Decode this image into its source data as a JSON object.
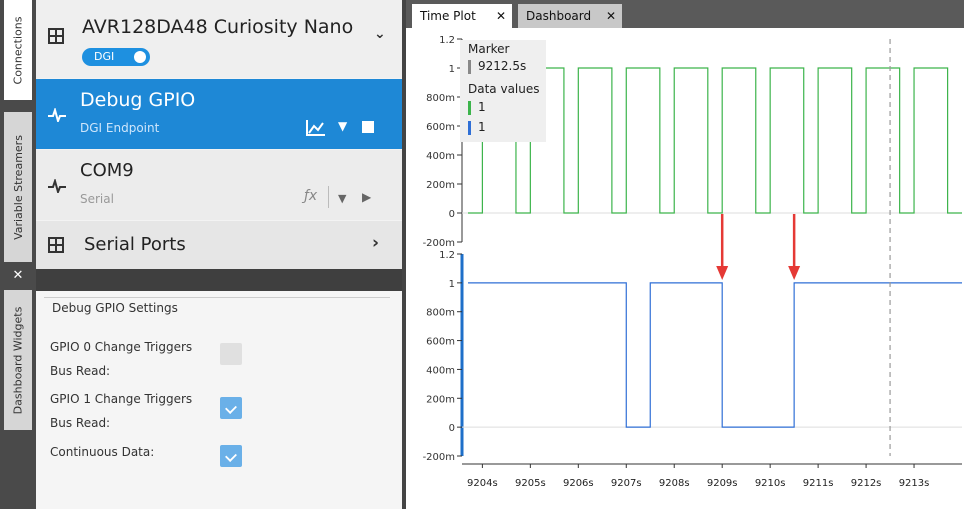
{
  "sidebar_tabs": [
    "Connections",
    "Variable Streamers",
    "Dashboard Widgets"
  ],
  "device": {
    "name": "AVR128DA48 Curiosity Nano",
    "badge": "DGI"
  },
  "sources": [
    {
      "title": "Debug GPIO",
      "subtitle": "DGI Endpoint"
    },
    {
      "title": "COM9",
      "subtitle": "Serial"
    }
  ],
  "serial_ports": {
    "label": "Serial Ports"
  },
  "settings": {
    "title": "Debug GPIO Settings",
    "items": [
      {
        "line1": "GPIO 0 Change Triggers",
        "line2": "Bus Read:",
        "checked": false
      },
      {
        "line1": "GPIO 1 Change Triggers",
        "line2": "Bus Read:",
        "checked": true
      },
      {
        "line1": "Continuous Data:",
        "line2": "",
        "checked": true
      }
    ]
  },
  "plot_tabs": [
    {
      "label": "Time Plot",
      "active": true
    },
    {
      "label": "Dashboard",
      "active": false
    }
  ],
  "legend": {
    "marker_title": "Marker",
    "marker_value": "9212.5s",
    "data_title": "Data values",
    "values": [
      "1",
      "1"
    ]
  },
  "colors": {
    "series_green": "#3cb44b",
    "series_blue": "#2f6fd6",
    "arrow": "#e53935",
    "accent": "#1e88d6"
  },
  "chart_data": [
    {
      "type": "line",
      "ylim": [
        -0.2,
        1.2
      ],
      "xlim": [
        9203.7,
        9214.0
      ],
      "ytick_labels": [
        "1.2",
        "1",
        "800m",
        "600m",
        "400m",
        "200m",
        "0",
        "-200m"
      ],
      "series": [
        {
          "x": [
            9203.7,
            9204.0,
            9204.0,
            9204.7,
            9204.7,
            9205.0,
            9205.0,
            9205.7,
            9205.7,
            9206.0,
            9206.0,
            9206.7,
            9206.7,
            9207.0,
            9207.0,
            9207.7,
            9207.7,
            9208.0,
            9208.0,
            9208.7,
            9208.7,
            9209.0,
            9209.0,
            9209.7,
            9209.7,
            9210.0,
            9210.0,
            9210.7,
            9210.7,
            9211.0,
            9211.0,
            9211.7,
            9211.7,
            9212.0,
            9212.0,
            9212.7,
            9212.7,
            9213.0,
            9213.0,
            9213.7,
            9213.7,
            9214.0
          ],
          "y": [
            0,
            0,
            1,
            1,
            0,
            0,
            1,
            1,
            0,
            0,
            1,
            1,
            0,
            0,
            1,
            1,
            0,
            0,
            1,
            1,
            0,
            0,
            1,
            1,
            0,
            0,
            1,
            1,
            0,
            0,
            1,
            1,
            0,
            0,
            1,
            1,
            0,
            0,
            1,
            1,
            0,
            0
          ]
        }
      ]
    },
    {
      "type": "line",
      "ylim": [
        -0.2,
        1.2
      ],
      "xlim": [
        9203.7,
        9214.0
      ],
      "ytick_labels": [
        "1.2",
        "1",
        "800m",
        "600m",
        "400m",
        "200m",
        "0",
        "-200m"
      ],
      "xtick_labels": [
        "9204s",
        "9205s",
        "9206s",
        "9207s",
        "9208s",
        "9209s",
        "9210s",
        "9211s",
        "9212s",
        "9213s"
      ],
      "x_ticks": [
        9204,
        9205,
        9206,
        9207,
        9208,
        9209,
        9210,
        9211,
        9212,
        9213
      ],
      "series": [
        {
          "x": [
            9203.7,
            9207.0,
            9207.0,
            9207.5,
            9207.5,
            9209.0,
            9209.0,
            9210.5,
            9210.5,
            9214.0
          ],
          "y": [
            1,
            1,
            0,
            0,
            1,
            1,
            0,
            0,
            1,
            1
          ]
        }
      ],
      "marker_x": 9212.5
    }
  ]
}
